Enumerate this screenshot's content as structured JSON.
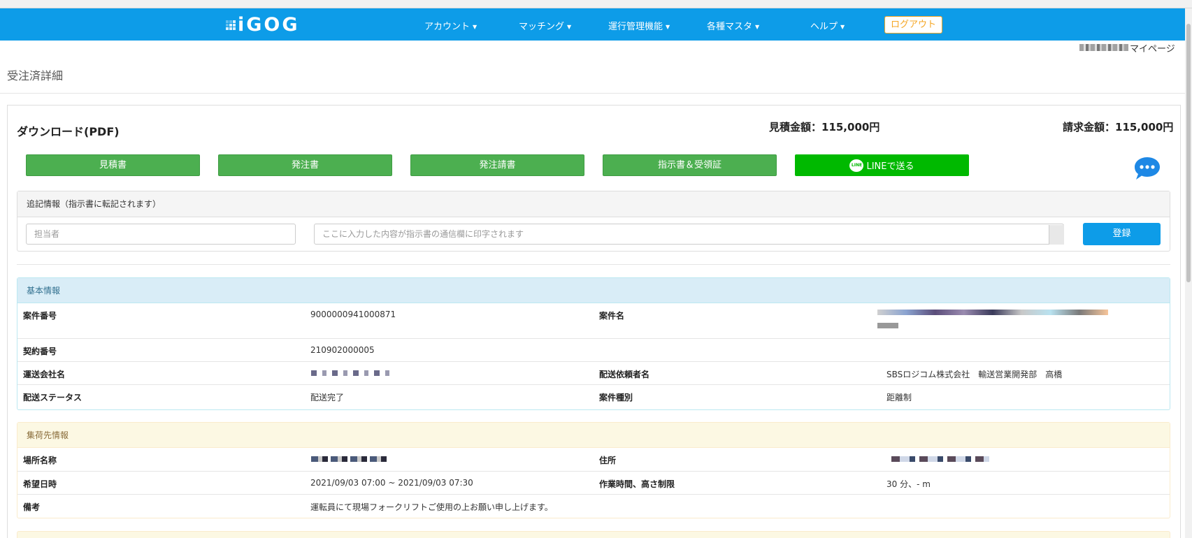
{
  "nav": {
    "logo": "iGOG",
    "items": [
      {
        "label": "アカウント"
      },
      {
        "label": "マッチング"
      },
      {
        "label": "運行管理機能"
      },
      {
        "label": "各種マスタ"
      },
      {
        "label": "ヘルプ"
      }
    ],
    "logout": "ログアウト",
    "mypage": "マイページ"
  },
  "page": {
    "title": "受注済詳細"
  },
  "download": {
    "title": "ダウンロード(PDF)",
    "estimate": "見積金額：115,000円",
    "invoice": "請求金額：115,000円",
    "buttons": [
      "見積書",
      "発注書",
      "発注請書",
      "指示書＆受領証"
    ],
    "line_button": "LINEで送る",
    "line_icon_text": "LINE"
  },
  "memo": {
    "heading": "追記情報（指示書に転記されます）",
    "person_placeholder": "担当者",
    "note_placeholder": "ここに入力した内容が指示書の通信欄に印字されます",
    "register": "登録"
  },
  "basic_info": {
    "heading": "基本情報",
    "rows": [
      {
        "l1": "案件番号",
        "v1": "9000000941000871",
        "l2": "案件名",
        "v2": ""
      },
      {
        "l1": "契約番号",
        "v1": "210902000005",
        "l2": "",
        "v2": ""
      },
      {
        "l1": "運送会社名",
        "v1": "",
        "l2": "配送依頼者名",
        "v2": "SBSロジコム株式会社　輸送営業開発部　高橋"
      },
      {
        "l1": "配送ステータス",
        "v1": "配送完了",
        "l2": "案件種別",
        "v2": "距離制"
      }
    ]
  },
  "pickup_info": {
    "heading": "集荷先情報",
    "rows": [
      {
        "l1": "場所名称",
        "v1": "",
        "l2": "住所",
        "v2": ""
      },
      {
        "l1": "希望日時",
        "v1": "2021/09/03 07:00 ~ 2021/09/03 07:30",
        "l2": "作業時間、高さ制限",
        "v2": "30 分、- m"
      },
      {
        "l1": "備考",
        "v1": "運転員にて現場フォークリフトご使用の上お願い申し上げます。",
        "l2": "",
        "v2": ""
      }
    ]
  },
  "colors": {
    "nav_bg": "#0d9ce8",
    "green_button": "#4caf50",
    "line_green": "#00b900",
    "logout_orange": "#f5a623"
  },
  "icons": {
    "chat": "chat-bubble-icon",
    "caret": "caret-down-icon"
  }
}
